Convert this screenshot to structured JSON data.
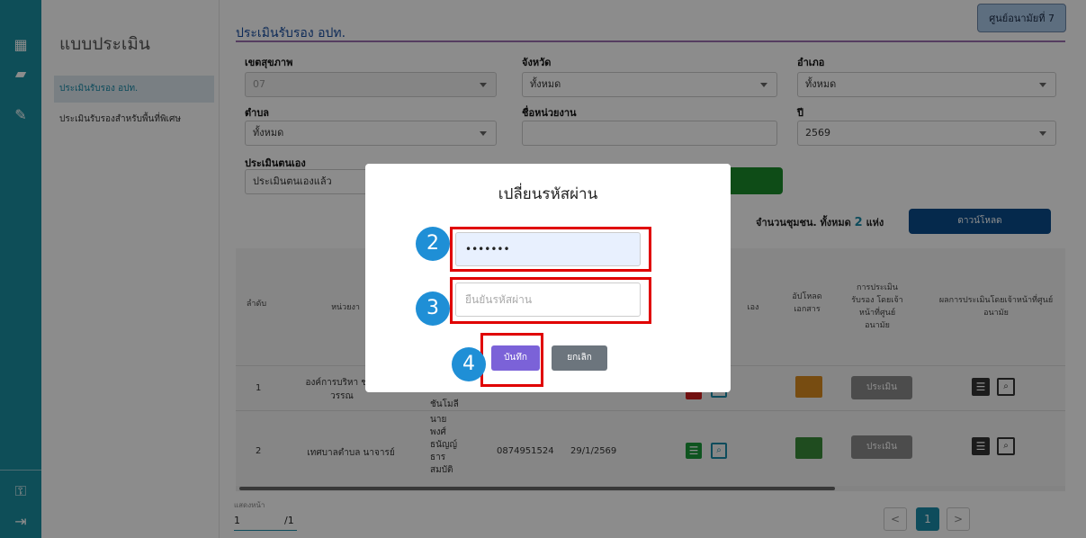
{
  "sidebar": {
    "title": "แบบประเมิน",
    "items": [
      {
        "label": "ประเมินรับรอง อปท."
      },
      {
        "label": "ประเมินรับรองสำหรับพื้นที่พิเศษ"
      }
    ]
  },
  "header": {
    "badge": "ศูนย์อนามัยที่ 7",
    "title": "ประเมินรับรอง อปท."
  },
  "filters": {
    "region_label": "เขตสุขภาพ",
    "region_value": "07",
    "province_label": "จังหวัด",
    "province_value": "ทั้งหมด",
    "district_label": "อำเภอ",
    "district_value": "ทั้งหมด",
    "subdistrict_label": "ตำบล",
    "subdistrict_value": "ทั้งหมด",
    "agency_label": "ชื่อหน่วยงาน",
    "agency_value": "",
    "year_label": "ปี",
    "year_value": "2569",
    "self_eval_label": "ประเมินตนเอง",
    "self_eval_value": "ประเมินตนเองแล้ว"
  },
  "summary": {
    "prefix": "จำนวนชุมชน. ทั้งหมด",
    "count": "2",
    "suffix": "แห่ง",
    "download_label": "ดาวน์โหลด"
  },
  "table": {
    "headers": {
      "seq": "ลำดับ",
      "agency": "หน่วยงา",
      "self": "เอง",
      "upload": "อัปโหลด เอกสาร",
      "center_eval": "การประเมิน รับรอง โดยเจ้า หน้าที่ศูนย์ อนามัย",
      "center_result": "ผลการประเมินโดยเจ้าหน้าที่ศูนย์ อนามัย"
    },
    "rows": [
      {
        "seq": "1",
        "agency": "องค์การบริหา ชานุวรรณ",
        "contact": "ชันโมลี"
      },
      {
        "seq": "2",
        "agency": "เทศบาลตำบล นาจารย์",
        "contact": "นาย พงศ์ ธนัญญ์ ธาร สมบัติ",
        "phone": "0874951524",
        "date": "29/1/2569"
      }
    ],
    "eval_label": "ประเมิน"
  },
  "pagination": {
    "label": "แสดงหน้า",
    "page": "1",
    "total": "/1",
    "prev": "<",
    "current": "1",
    "next": ">"
  },
  "modal": {
    "title": "เปลี่ยนรหัสผ่าน",
    "password_value": "•••••••",
    "confirm_placeholder": "ยืนยันรหัสผ่าน",
    "save_label": "บันทึก",
    "cancel_label": "ยกเลิก"
  },
  "steps": [
    "2",
    "3",
    "4"
  ],
  "colors": {
    "rail": "#1b8fa0",
    "title": "#1a4fa0",
    "download": "#0a4c8a",
    "save": "#7b62d8",
    "step_circle": "#1f8fd6",
    "highlight": "#e00000"
  }
}
